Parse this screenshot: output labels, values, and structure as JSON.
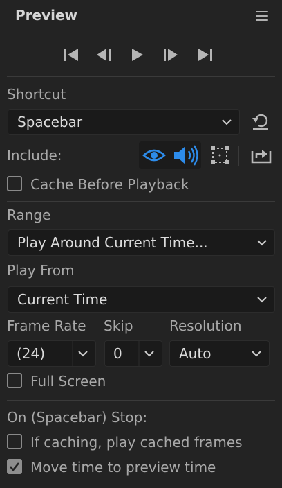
{
  "panel": {
    "title": "Preview",
    "menu_icon": "hamburger-menu-icon"
  },
  "transport": {
    "buttons": [
      {
        "name": "first-frame",
        "icon": "skip-to-start-icon"
      },
      {
        "name": "previous-frame",
        "icon": "step-back-icon"
      },
      {
        "name": "play",
        "icon": "play-icon"
      },
      {
        "name": "next-frame",
        "icon": "step-forward-icon"
      },
      {
        "name": "last-frame",
        "icon": "skip-to-end-icon"
      }
    ]
  },
  "shortcut": {
    "label": "Shortcut",
    "value": "Spacebar",
    "reset_icon": "reset-icon"
  },
  "include": {
    "label": "Include:",
    "video_icon": "eye-icon",
    "audio_icon": "speaker-icon",
    "overlays_icon": "overlay-frame-icon",
    "layer_controls_icon": "layer-controls-icon",
    "active_color": "#2d8ceb"
  },
  "cache_before_playback": {
    "label": "Cache Before Playback",
    "checked": false
  },
  "range": {
    "label": "Range",
    "value": "Play Around Current Time..."
  },
  "play_from": {
    "label": "Play From",
    "value": "Current Time"
  },
  "frame_rate": {
    "label": "Frame Rate",
    "value": "(24)"
  },
  "skip": {
    "label": "Skip",
    "value": "0"
  },
  "resolution": {
    "label": "Resolution",
    "value": "Auto"
  },
  "full_screen": {
    "label": "Full Screen",
    "checked": false
  },
  "on_stop": {
    "label": "On (Spacebar) Stop:",
    "options": [
      {
        "label": "If caching, play cached frames",
        "checked": false
      },
      {
        "label": "Move time to preview time",
        "checked": true
      }
    ]
  }
}
